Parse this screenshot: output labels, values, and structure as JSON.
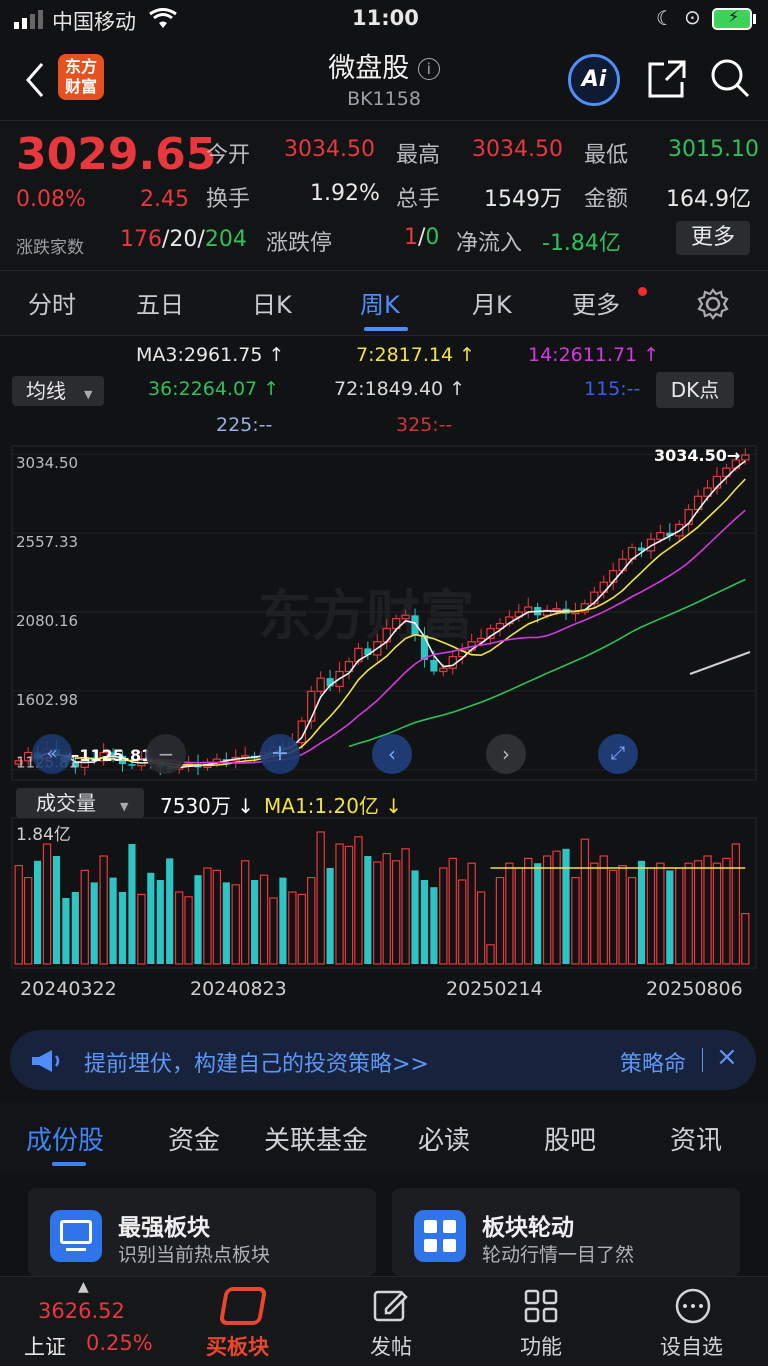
{
  "status_bar": {
    "carrier": "中国移动",
    "time": "11:00"
  },
  "header": {
    "title": "微盘股",
    "code": "BK1158",
    "logo_line1": "东方",
    "logo_line2": "财富",
    "ai_label": "Ai"
  },
  "quote": {
    "price": "3029.65",
    "pct": "0.08%",
    "change": "2.45",
    "open_label": "今开",
    "open": "3034.50",
    "high_label": "最高",
    "high": "3034.50",
    "low_label": "最低",
    "low": "3015.10",
    "turnover_label": "换手",
    "turnover": "1.92%",
    "volume_label": "总手",
    "volume": "1549万",
    "amount_label": "金额",
    "amount": "164.9亿",
    "breadth_label": "涨跌家数",
    "up": "176",
    "flat": "20",
    "down": "204",
    "limit_label": "涨跌停",
    "limit_up": "1",
    "limit_down": "0",
    "netflow_label": "净流入",
    "netflow": "-1.84亿",
    "more": "更多"
  },
  "kline_tabs": [
    "分时",
    "五日",
    "日K",
    "周K",
    "月K",
    "更多"
  ],
  "active_tab": "周K",
  "ma": {
    "ma3": "MA3:2961.75 ↑",
    "ma7": "7:2817.14 ↑",
    "ma14": "14:2611.71 ↑",
    "ma36": "36:2264.07 ↑",
    "ma72": "72:1849.40 ↑",
    "ma115": "115:--",
    "ma225": "225:--",
    "ma325": "325:--",
    "selector": "均线",
    "dk": "DK点"
  },
  "chart_data": {
    "type": "candlestick",
    "y_ticks": [
      "3034.50",
      "2557.33",
      "2080.16",
      "1602.98",
      "1125.81"
    ],
    "high_marker": "3034.50→",
    "low_marker": "←1125.81",
    "closes": [
      1180,
      1230,
      1190,
      1250,
      1210,
      1170,
      1140,
      1200,
      1180,
      1230,
      1210,
      1160,
      1150,
      1190,
      1170,
      1140,
      1130,
      1150,
      1160,
      1140,
      1170,
      1190,
      1180,
      1200,
      1210,
      1195,
      1230,
      1260,
      1250,
      1290,
      1420,
      1600,
      1680,
      1630,
      1720,
      1780,
      1860,
      1820,
      1900,
      1980,
      2040,
      2060,
      1940,
      1790,
      1720,
      1740,
      1810,
      1850,
      1900,
      1920,
      1980,
      2010,
      2050,
      2080,
      2110,
      2060,
      2090,
      2100,
      2070,
      2080,
      2130,
      2200,
      2260,
      2330,
      2400,
      2470,
      2450,
      2520,
      2560,
      2540,
      2610,
      2700,
      2780,
      2830,
      2900,
      2950,
      3000,
      3029.65
    ],
    "colors": [
      "#e8383d",
      "#2fc4c4",
      "#e8383d",
      "#2fc4c4",
      "#e8383d"
    ],
    "volume_label": "成交量",
    "volume_value": "7530万 ↓",
    "volume_ma": "MA1:1.20亿 ↓",
    "volume_top": "1.84亿",
    "volumes": [
      0.82,
      0.72,
      0.86,
      1.0,
      0.9,
      0.55,
      0.6,
      0.78,
      0.68,
      0.9,
      0.72,
      0.6,
      1.0,
      0.58,
      0.76,
      0.7,
      0.88,
      0.6,
      0.56,
      0.74,
      0.8,
      0.78,
      0.68,
      0.66,
      0.86,
      0.7,
      0.74,
      0.55,
      0.72,
      0.6,
      0.58,
      0.72,
      1.1,
      0.8,
      1.0,
      0.98,
      1.06,
      0.9,
      0.85,
      0.92,
      0.86,
      0.96,
      0.78,
      0.7,
      0.64,
      0.8,
      0.88,
      0.7,
      0.84,
      0.6,
      0.16,
      0.72,
      0.84,
      0.8,
      0.88,
      0.84,
      0.9,
      0.94,
      0.96,
      0.72,
      1.04,
      0.84,
      0.9,
      0.78,
      0.82,
      0.72,
      0.86,
      0.8,
      0.84,
      0.78,
      0.8,
      0.84,
      0.86,
      0.9,
      0.84,
      0.88,
      1.0,
      0.42
    ],
    "dates": [
      "20240322",
      "20240823",
      "20250214",
      "20250806"
    ]
  },
  "banner": {
    "text": "提前埋伏，构建自己的投资策略>>",
    "right": "策略命"
  },
  "sub_tabs": [
    "成份股",
    "资金",
    "关联基金",
    "必读",
    "股吧",
    "资讯"
  ],
  "cards": [
    {
      "title": "最强板块",
      "sub": "识别当前热点板块"
    },
    {
      "title": "板块轮动",
      "sub": "轮动行情一目了然"
    }
  ],
  "footer": {
    "index_value": "3626.52",
    "index_name": "上证",
    "index_pct": "0.25%",
    "buy_label": "买板块",
    "post_label": "发帖",
    "func_label": "功能",
    "watch_label": "设自选"
  }
}
